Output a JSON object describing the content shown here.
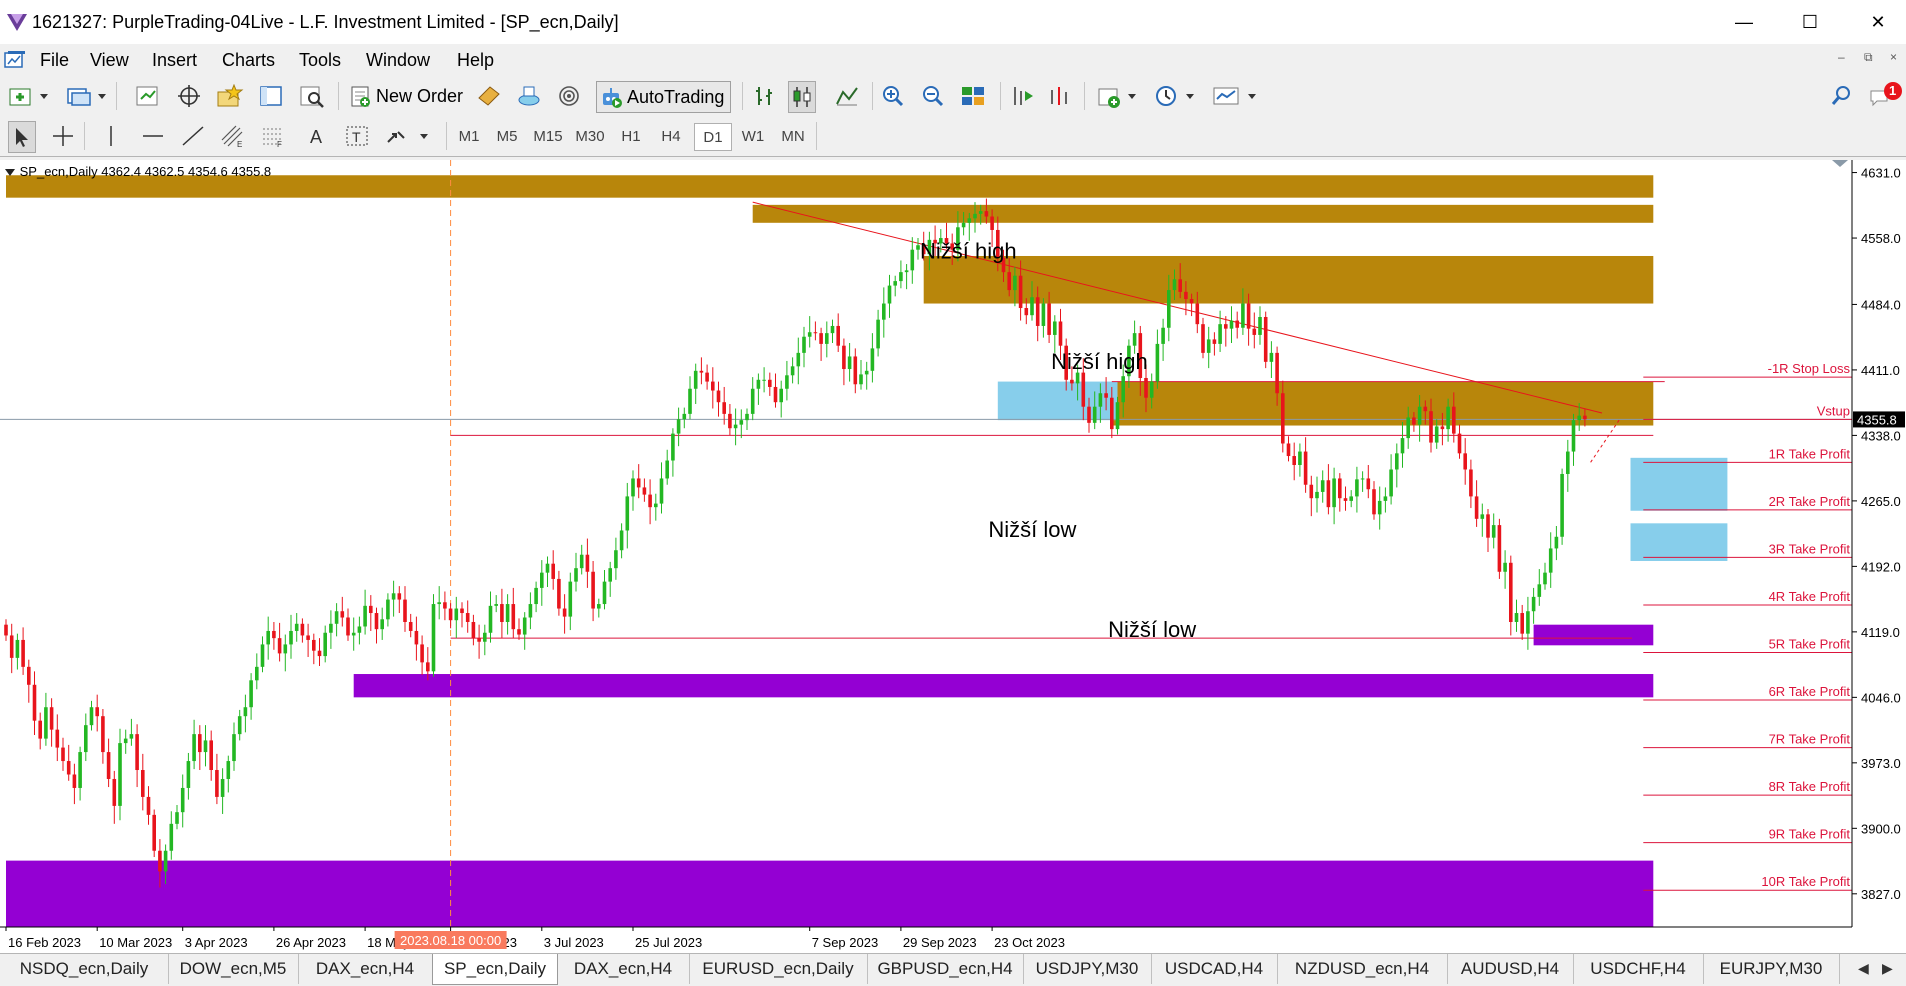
{
  "window": {
    "title": "1621327: PurpleTrading-04Live - L.F. Investment Limited - [SP_ecn,Daily]",
    "minimize_glyph": "—",
    "maximize_glyph": "☐",
    "close_glyph": "✕"
  },
  "menu": {
    "items": [
      "File",
      "View",
      "Insert",
      "Charts",
      "Tools",
      "Window",
      "Help"
    ],
    "mdi_buttons": [
      "–",
      "⧉",
      "×"
    ]
  },
  "toolbar": {
    "new_order": "New Order",
    "autotrading": "AutoTrading",
    "notification_count": "1"
  },
  "timeframes": [
    "M1",
    "M5",
    "M15",
    "M30",
    "H1",
    "H4",
    "D1",
    "W1",
    "MN"
  ],
  "active_timeframe": "D1",
  "chart": {
    "info": "SP_ecn,Daily  4362.4 4362.5 4354.6 4355.8",
    "current_price_label": "4355.8",
    "vertical_line_label": "2023.08.18 00:00",
    "annotations": [
      "Nižší high",
      "Nižší high",
      "Nižší low",
      "Nižší low"
    ],
    "level_labels": [
      "-1R Stop Loss",
      "Vstup",
      "1R Take Profit",
      "2R Take Profit",
      "3R Take Profit",
      "4R Take Profit",
      "5R Take Profit",
      "6R Take Profit",
      "7R Take Profit",
      "8R Take Profit",
      "9R Take Profit",
      "10R Take Profit"
    ],
    "colors": {
      "bull": "#23b723",
      "bear": "#e8141c",
      "resistance_zone": "#b8860b",
      "support_zone": "#9400d3",
      "target_zone": "#87ceeb",
      "levels": "#dc143c"
    }
  },
  "chart_data": {
    "type": "candlestick",
    "symbol": "SP_ecn",
    "timeframe": "Daily",
    "last": {
      "open": 4362.4,
      "high": 4362.5,
      "low": 4354.6,
      "close": 4355.8
    },
    "y_ticks": [
      4631.0,
      4558.0,
      4484.0,
      4411.0,
      4338.0,
      4265.0,
      4192.0,
      4119.0,
      4046.0,
      3973.0,
      3900.0,
      3827.0
    ],
    "x_ticks": [
      "16 Feb 2023",
      "10 Mar 2023",
      "3 Apr 2023",
      "26 Apr 2023",
      "18 May 2023",
      "9 Jun 2023",
      "3 Jul 2023",
      "25 Jul 2023",
      "7 Sep 2023",
      "29 Sep 2023",
      "23 Oct 2023"
    ],
    "ylim": [
      3790,
      4645
    ],
    "levels": [
      {
        "label": "-1R Stop Loss",
        "value": 4403
      },
      {
        "label": "Vstup",
        "value": 4355.8
      },
      {
        "label": "1R Take Profit",
        "value": 4308
      },
      {
        "label": "2R Take Profit",
        "value": 4255
      },
      {
        "label": "3R Take Profit",
        "value": 4202
      },
      {
        "label": "4R Take Profit",
        "value": 4149
      },
      {
        "label": "5R Take Profit",
        "value": 4096
      },
      {
        "label": "6R Take Profit",
        "value": 4043
      },
      {
        "label": "7R Take Profit",
        "value": 3990
      },
      {
        "label": "8R Take Profit",
        "value": 3937
      },
      {
        "label": "9R Take Profit",
        "value": 3884
      },
      {
        "label": "10R Take Profit",
        "value": 3831
      }
    ],
    "closes": [
      4115,
      4090,
      4110,
      4080,
      4060,
      4020,
      4000,
      4035,
      4010,
      3990,
      3975,
      3960,
      3945,
      3985,
      4015,
      4035,
      4025,
      3985,
      3955,
      3925,
      3995,
      4000,
      4005,
      3965,
      3935,
      3915,
      3875,
      3852,
      3875,
      3905,
      3918,
      3945,
      3975,
      4005,
      3985,
      3998,
      3965,
      3935,
      3955,
      3975,
      4005,
      4025,
      4035,
      4065,
      4080,
      4105,
      4120,
      4112,
      4095,
      4105,
      4120,
      4128,
      4115,
      4110,
      4098,
      4092,
      4118,
      4128,
      4142,
      4135,
      4115,
      4118,
      4125,
      4148,
      4140,
      4122,
      4133,
      4155,
      4162,
      4155,
      4130,
      4120,
      4105,
      4085,
      4075,
      4150,
      4152,
      4145,
      4132,
      4145,
      4140,
      4130,
      4112,
      4108,
      4118,
      4148,
      4150,
      4130,
      4150,
      4122,
      4116,
      4135,
      4150,
      4168,
      4185,
      4195,
      4178,
      4145,
      4136,
      4175,
      4190,
      4205,
      4186,
      4145,
      4150,
      4175,
      4190,
      4210,
      4232,
      4270,
      4290,
      4280,
      4272,
      4258,
      4262,
      4290,
      4310,
      4340,
      4356,
      4362,
      4390,
      4410,
      4408,
      4398,
      4388,
      4375,
      4362,
      4346,
      4350,
      4355,
      4362,
      4390,
      4400,
      4400,
      4392,
      4375,
      4390,
      4405,
      4415,
      4430,
      4448,
      4453,
      4452,
      4440,
      4452,
      4460,
      4438,
      4412,
      4426,
      4395,
      4406,
      4410,
      4435,
      4467,
      4485,
      4505,
      4510,
      4520,
      4522,
      4545,
      4550,
      4540,
      4556,
      4552,
      4558,
      4552,
      4545,
      4570,
      4575,
      4580,
      4585,
      4588,
      4582,
      4567,
      4536,
      4520,
      4500,
      4516,
      4480,
      4472,
      4492,
      4460,
      4485,
      4450,
      4465,
      4438,
      4400,
      4396,
      4408,
      4370,
      4352,
      4370,
      4385,
      4380,
      4345,
      4375,
      4404,
      4438,
      4452,
      4402,
      4380,
      4398,
      4440,
      4458,
      4500,
      4512,
      4498,
      4490,
      4485,
      4462,
      4430,
      4445,
      4440,
      4462,
      4457,
      4466,
      4458,
      4485,
      4457,
      4450,
      4470,
      4420,
      4430,
      4385,
      4329,
      4315,
      4305,
      4320,
      4283,
      4268,
      4275,
      4288,
      4258,
      4290,
      4268,
      4265,
      4270,
      4289,
      4290,
      4278,
      4250,
      4265,
      4270,
      4300,
      4318,
      4335,
      4358,
      4350,
      4370,
      4365,
      4330,
      4348,
      4345,
      4370,
      4340,
      4318,
      4300,
      4270,
      4245,
      4250,
      4224,
      4238,
      4186,
      4196,
      4130,
      4140,
      4117,
      4142,
      4158,
      4172,
      4185,
      4212,
      4225,
      4295,
      4320,
      4355,
      4360,
      4356
    ]
  }
}
